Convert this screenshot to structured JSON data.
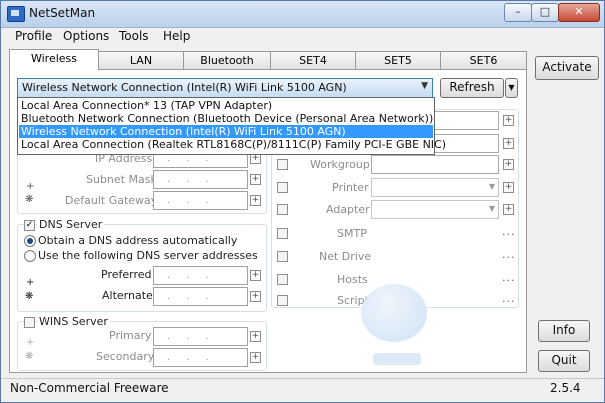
{
  "window": {
    "title": "NetSetMan"
  },
  "menu": [
    "Profile",
    "Options",
    "Tools",
    "Help"
  ],
  "tabs": [
    "Wireless",
    "LAN",
    "Bluetooth",
    "SET4",
    "SET5",
    "SET6"
  ],
  "adapter": {
    "selected": "Wireless Network Connection (Intel(R) WiFi Link 5100 AGN)",
    "options": [
      "Local Area Connection* 13 (TAP VPN Adapter)",
      "Bluetooth Network Connection (Bluetooth Device (Personal Area Network))",
      "Wireless Network Connection (Intel(R) WiFi Link 5100 AGN)",
      "Local Area Connection (Realtek RTL8168C(P)/8111C(P) Family PCI-E GBE NIC)"
    ]
  },
  "buttons": {
    "refresh": "Refresh",
    "activate": "Activate",
    "info": "Info",
    "quit": "Quit"
  },
  "ip": {
    "ip_address": "IP Address",
    "subnet_mask": "Subnet Mask",
    "default_gateway": "Default Gateway"
  },
  "dns": {
    "title": "DNS Server",
    "auto": "Obtain a DNS address automatically",
    "manual": "Use the following DNS server addresses",
    "preferred": "Preferred",
    "alternate": "Alternate"
  },
  "wins": {
    "title": "WINS Server",
    "primary": "Primary",
    "secondary": "Secondary"
  },
  "right": {
    "workgroup": "Workgroup",
    "printer": "Printer",
    "adapter": "Adapter",
    "smtp": "SMTP",
    "net_drive": "Net Drive",
    "hosts": "Hosts",
    "script": "Script"
  },
  "status": {
    "left": "Non-Commercial Freeware",
    "version": "2.5.4"
  }
}
